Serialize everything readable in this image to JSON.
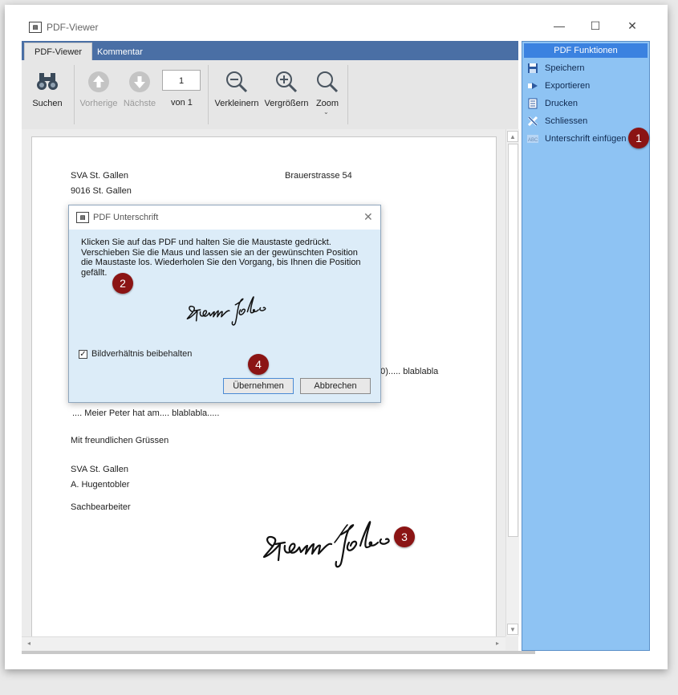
{
  "window": {
    "title": "PDF-Viewer",
    "controls": {
      "minimize": "—",
      "maximize": "☐",
      "close": "✕"
    }
  },
  "ribbon": {
    "tabs": [
      {
        "label": "PDF-Viewer"
      },
      {
        "label": "Kommentar"
      }
    ],
    "buttons": {
      "search": "Suchen",
      "prev": "Vorherige",
      "next": "Nächste",
      "page_value": "1",
      "page_of": "von 1",
      "zoom_out": "Verkleinern",
      "zoom_in": "Vergrößern",
      "zoom": "Zoom"
    }
  },
  "document": {
    "sender_name": "SVA St. Gallen",
    "sender_city": "9016 St. Gallen",
    "street": "Brauerstrasse 54",
    "partial_line": "00)..... blablabla",
    "body_line": ".... Meier Peter hat am.... blablabla.....",
    "closing": "Mit freundlichen Grüssen",
    "sig_org": "SVA St. Gallen",
    "sig_name": "A. Hugentobler",
    "sig_role": "Sachbearbeiter"
  },
  "sidebar": {
    "header": "PDF Funktionen",
    "items": [
      {
        "label": "Speichern"
      },
      {
        "label": "Exportieren"
      },
      {
        "label": "Drucken"
      },
      {
        "label": "Schliessen"
      },
      {
        "label": "Unterschrift einfügen"
      }
    ]
  },
  "dialog": {
    "title": "PDF Unterschrift",
    "instructions": [
      "Klicken Sie auf das PDF und halten Sie die Maustaste gedrückt.",
      "Verschieben Sie die Maus und lassen sie an der gewünschten Position",
      "die Maustaste los. Wiederholen Sie den Vorgang, bis Ihnen die Position",
      "gefällt."
    ],
    "checkbox_label": "Bildverhältnis beibehalten",
    "checkbox_checked": true,
    "ok_label": "Übernehmen",
    "cancel_label": "Abbrechen"
  },
  "callouts": [
    "1",
    "2",
    "3",
    "4"
  ],
  "colors": {
    "accent": "#4a6fa5",
    "sidebar": "#8ec3f3",
    "sidebar_header": "#3b82e0",
    "badge": "#8b1414"
  }
}
